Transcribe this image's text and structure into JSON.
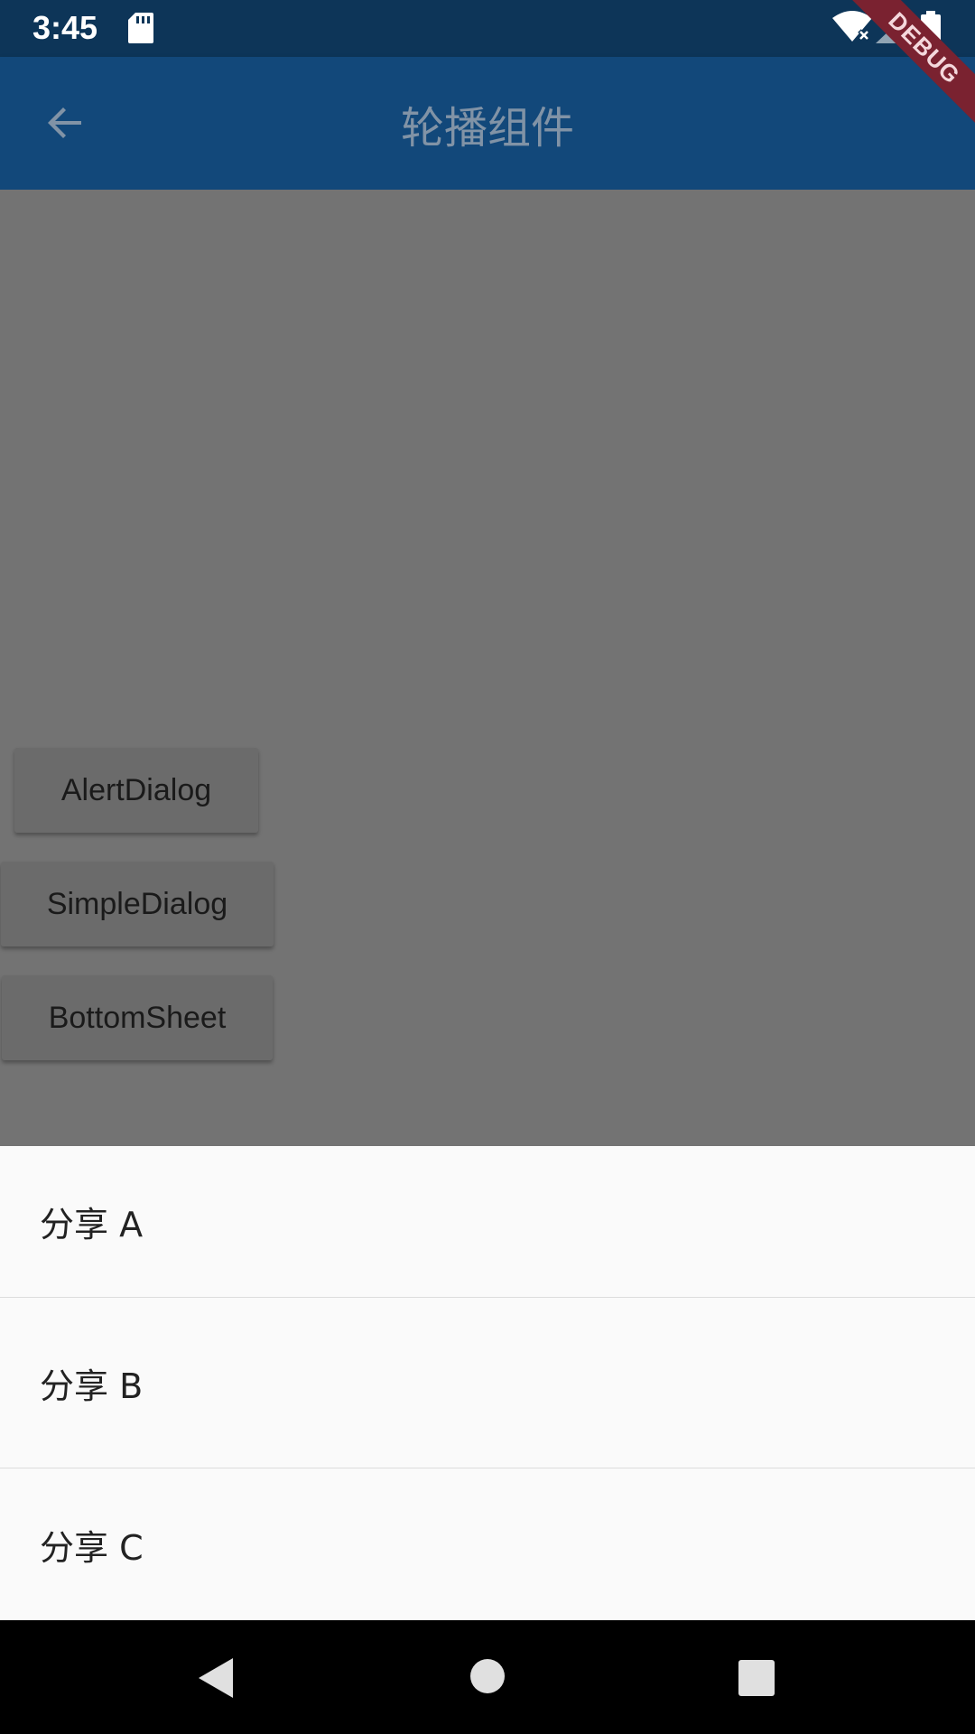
{
  "status_bar": {
    "time": "3:45",
    "icons": [
      "sd-card-icon",
      "wifi-off-icon",
      "signal-icon",
      "battery-icon"
    ]
  },
  "app_bar": {
    "title": "轮播组件",
    "back_icon": "arrow-back-icon",
    "background": "#12487a"
  },
  "debug_banner": {
    "label": "DEBUG"
  },
  "buttons": {
    "alert_dialog": "AlertDialog",
    "simple_dialog": "SimpleDialog",
    "bottom_sheet": "BottomSheet"
  },
  "bottom_sheet": {
    "items": [
      {
        "label": "分享 A"
      },
      {
        "label": "分享 B"
      },
      {
        "label": "分享 C"
      }
    ]
  },
  "nav_bar": {
    "icons": [
      "nav-back-icon",
      "nav-home-icon",
      "nav-recents-icon"
    ]
  }
}
